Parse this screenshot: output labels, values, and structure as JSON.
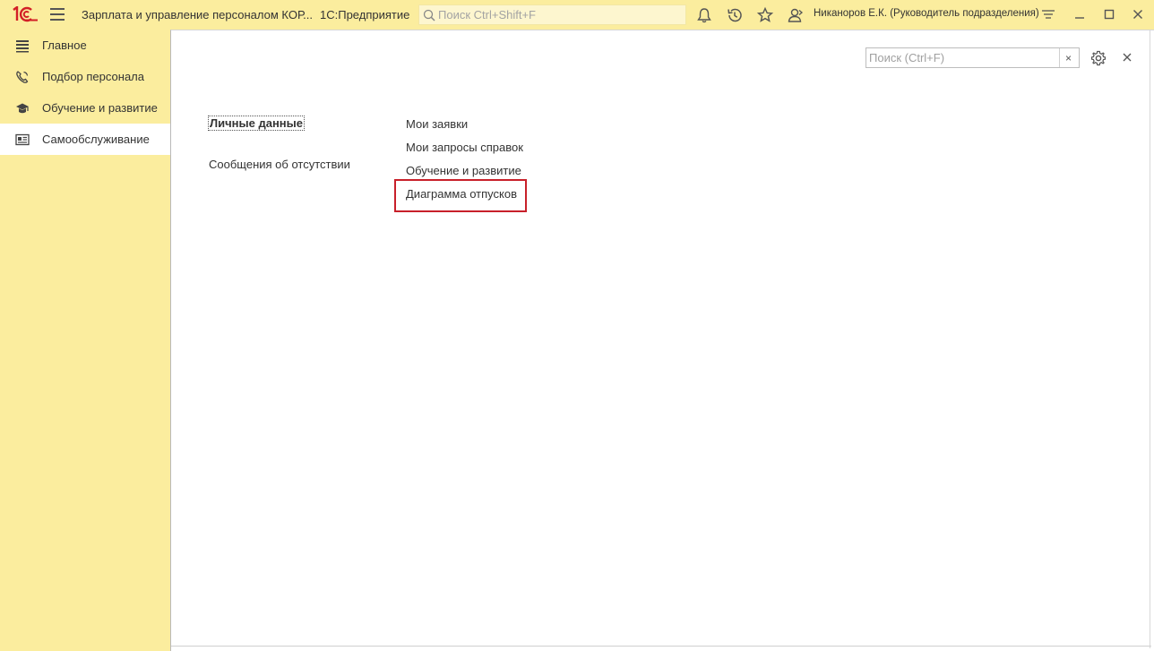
{
  "topbar": {
    "app_title": "Зарплата и управление персоналом КОР...",
    "platform": "1С:Предприятие",
    "search_placeholder": "Поиск Ctrl+Shift+F",
    "user": "Никаноров Е.К. (Руководитель подразделения)",
    "icons": [
      "bell-icon",
      "history-icon",
      "star-icon",
      "user-switch-icon",
      "menu-settings-icon",
      "minimize-icon",
      "maximize-icon",
      "close-icon"
    ]
  },
  "sidebar": {
    "items": [
      {
        "label": "Главное",
        "icon": "hamburger-list-icon",
        "active": false
      },
      {
        "label": "Подбор персонала",
        "icon": "phone-icon",
        "active": false
      },
      {
        "label": "Обучение и развитие",
        "icon": "graduation-cap-icon",
        "active": false
      },
      {
        "label": "Самообслуживание",
        "icon": "id-card-icon",
        "active": true
      }
    ]
  },
  "form": {
    "search_placeholder": "Поиск (Ctrl+F)",
    "clear_label": "×",
    "column1": [
      "Личные данные",
      "Сообщения об отсутствии"
    ],
    "column2": [
      "Мои заявки",
      "Мои запросы справок",
      "Обучение и развитие",
      "Диаграмма отпусков"
    ]
  },
  "colors": {
    "panel_bg": "#fbed9e",
    "highlight": "#c8202a",
    "logo_red": "#d21f26"
  }
}
